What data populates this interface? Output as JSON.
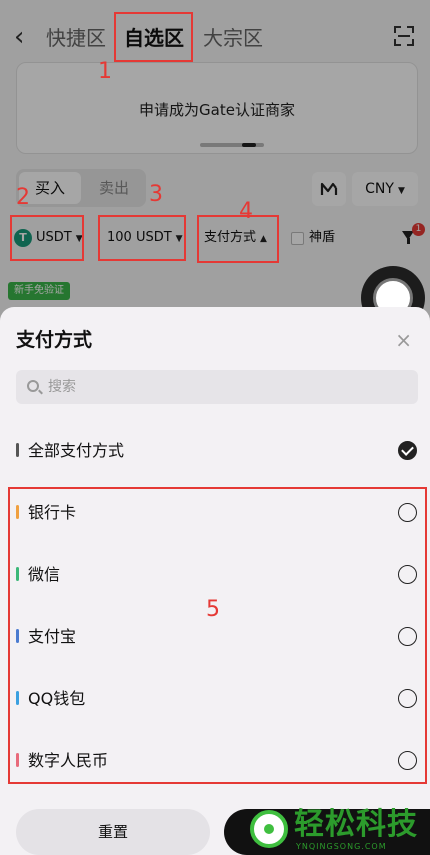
{
  "header": {
    "back_glyph": "‹",
    "tabs": [
      {
        "label": "快捷区"
      },
      {
        "label": "自选区"
      },
      {
        "label": "大宗区"
      }
    ]
  },
  "banner": {
    "text": "申请成为Gate认证商家"
  },
  "trade_toggle": {
    "buy_label": "买入",
    "sell_label": "卖出"
  },
  "currency": {
    "label": "CNY"
  },
  "filters": {
    "coin_icon_letter": "T",
    "coin": "USDT",
    "amount": "100 USDT",
    "payment": "支付方式",
    "shield_label": "神盾",
    "filter_badge": "1"
  },
  "new_user_tag": "新手免验证",
  "annotations": [
    "1",
    "2",
    "3",
    "4",
    "5"
  ],
  "sheet": {
    "title": "支付方式",
    "close_glyph": "×",
    "search_placeholder": "搜索",
    "options": [
      {
        "label": "全部支付方式",
        "color": "#555555",
        "selected": true
      },
      {
        "label": "银行卡",
        "color": "#f0a040",
        "selected": false
      },
      {
        "label": "微信",
        "color": "#3cb878",
        "selected": false
      },
      {
        "label": "支付宝",
        "color": "#4a7bd0",
        "selected": false
      },
      {
        "label": "QQ钱包",
        "color": "#3aa0e0",
        "selected": false
      },
      {
        "label": "数字人民币",
        "color": "#e86a7a",
        "selected": false
      }
    ],
    "reset_label": "重置"
  },
  "watermark": {
    "name": "轻松科技",
    "site": "YNQINGSONG.COM"
  },
  "colors": {
    "annotation_red": "#e53935",
    "brand_green": "#3fbf3f"
  }
}
